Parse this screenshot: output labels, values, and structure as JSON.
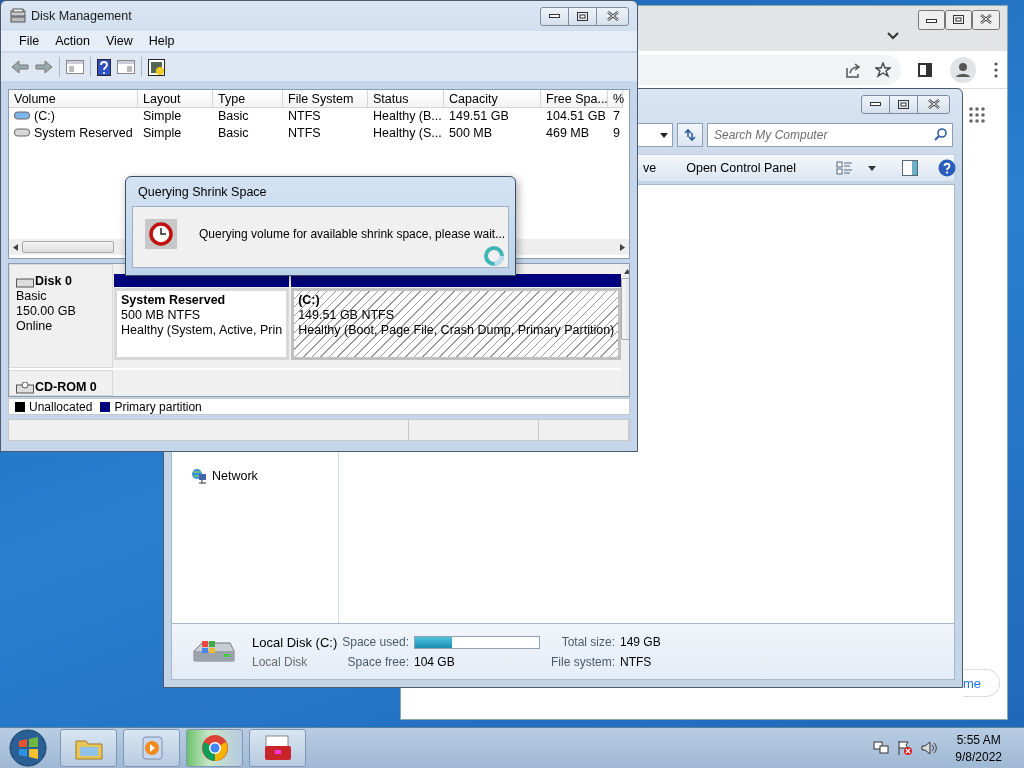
{
  "chrome_window": {
    "pill_text": "me"
  },
  "explorer_window": {
    "search": {
      "placeholder": "Search My Computer"
    },
    "toolbar": [
      "ve",
      "Open Control Panel"
    ],
    "navigation": [
      {
        "label": "Network"
      }
    ],
    "details": {
      "name": "Local Disk (C:)",
      "type": "Local Disk",
      "space_used_label": "Space used:",
      "space_used": {
        "level": 0.3
      },
      "space_free_label": "Space free:",
      "space_free": "104 GB",
      "total_size_label": "Total size:",
      "total_size": "149 GB",
      "file_system_label": "File system:",
      "file_system": "NTFS"
    }
  },
  "disk_management": {
    "title": "Disk Management",
    "menu": [
      "File",
      "Action",
      "View",
      "Help"
    ],
    "table": {
      "columns": [
        "Volume",
        "Layout",
        "Type",
        "File System",
        "Status",
        "Capacity",
        "Free Spa...",
        "%"
      ],
      "rows": [
        {
          "cells": [
            "(C:)",
            "Simple",
            "Basic",
            "NTFS",
            "Healthy (B...",
            "149.51 GB",
            "104.51 GB",
            "7"
          ]
        },
        {
          "cells": [
            "System Reserved",
            "Simple",
            "Basic",
            "NTFS",
            "Healthy (S...",
            "500 MB",
            "469 MB",
            "9"
          ]
        }
      ]
    },
    "disks": [
      {
        "name": "Disk 0",
        "lines": [
          "Basic",
          "150.00 GB",
          "Online"
        ],
        "partitions": [
          {
            "name": "System Reserved",
            "size": "500 MB NTFS",
            "status": "Healthy (System, Active, Prin",
            "selected": false
          },
          {
            "name": "(C:)",
            "size": "149.51 GB NTFS",
            "status": "Healthy (Boot, Page File, Crash Dump, Primary Partition)",
            "selected": true
          }
        ]
      },
      {
        "name": "CD-ROM 0"
      }
    ],
    "legend": [
      {
        "label": "Unallocated",
        "color": "#000000"
      },
      {
        "label": "Primary partition",
        "color": "#00007f"
      }
    ]
  },
  "dialog": {
    "title": "Querying Shrink Space",
    "message": "Querying volume for available shrink space, please wait..."
  },
  "taskbar": {
    "time": "5:55 AM",
    "date": "9/8/2022"
  }
}
